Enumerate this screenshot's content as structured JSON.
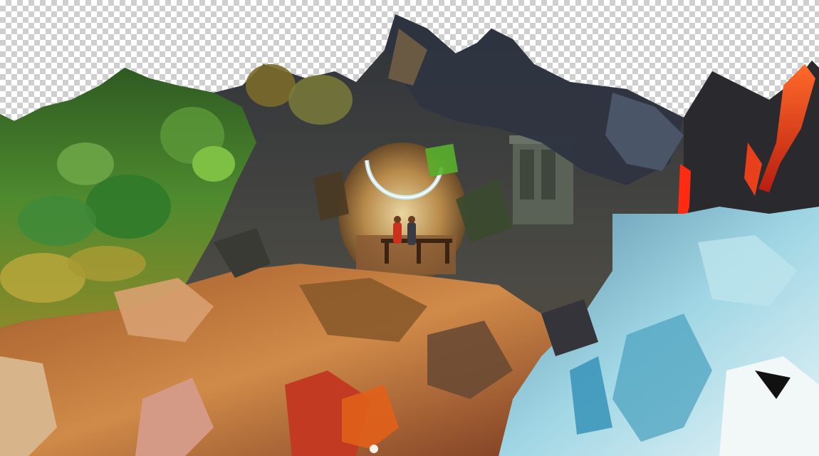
{
  "image": {
    "kind": "photo-collage",
    "background": "transparency-checkerboard",
    "palette": {
      "checker_light": "#ffffff",
      "checker_dark": "#cfcfcf",
      "forest_green": "#3f6b2a",
      "moss_yellow": "#b8a63a",
      "bark_brown": "#5a3d22",
      "slate_gray": "#4b5560",
      "lava_red": "#e8401a",
      "ice_blue": "#7cc3d6",
      "sand_orange": "#c97a3e",
      "portal_glow": "#c8f2ff"
    },
    "regions": [
      "forest-moss-region",
      "rock-mountain-region",
      "volcanic-lava-region",
      "glacier-ice-region",
      "desert-canyon-region",
      "central-portal-scene"
    ]
  }
}
